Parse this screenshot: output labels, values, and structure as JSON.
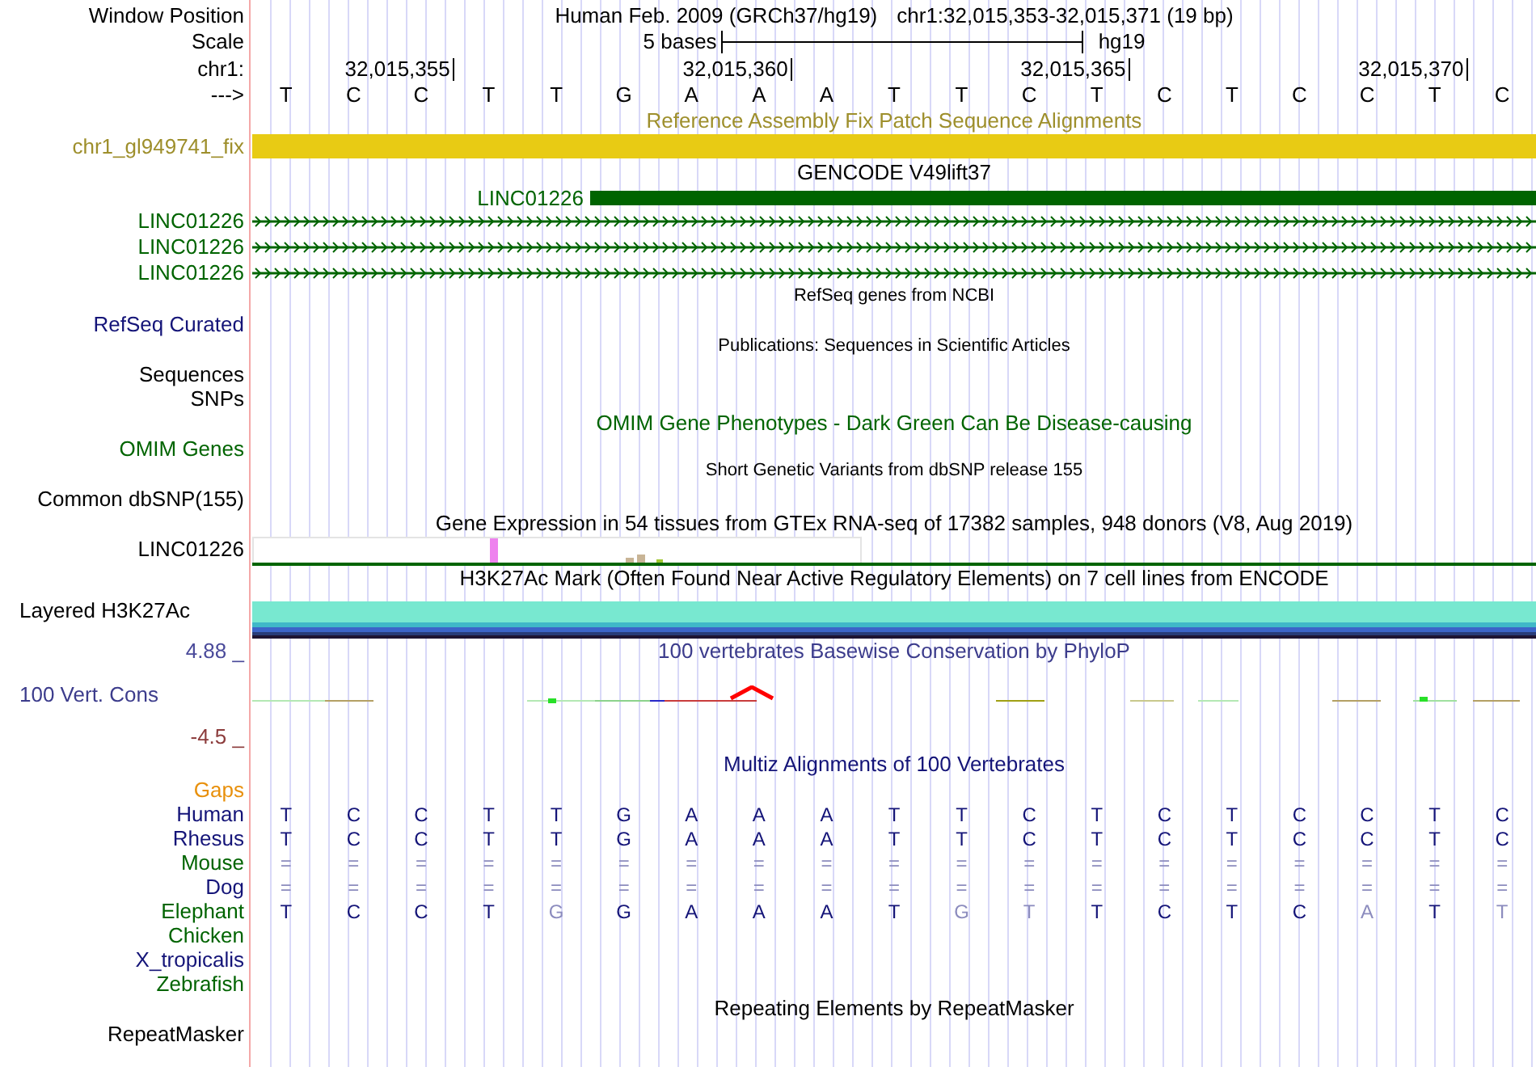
{
  "rows": [
    {
      "kind": "header",
      "label": "Window Position",
      "color": "#000000",
      "text": "Human Feb. 2009 (GRCh37/hg19)",
      "position": "chr1:32,015,353-32,015,371 (19 bp)"
    },
    {
      "kind": "scale",
      "label": "Scale",
      "color": "#000000",
      "text": "5 bases",
      "assembly": "hg19"
    },
    {
      "kind": "ruler",
      "label": "chr1:",
      "color": "#000000",
      "ticks": [
        "32,015,355",
        "32,015,360",
        "32,015,365",
        "32,015,370"
      ]
    },
    {
      "kind": "bases",
      "label": "--->",
      "color": "#000000",
      "bases": [
        "T",
        "C",
        "C",
        "T",
        "T",
        "G",
        "A",
        "A",
        "A",
        "T",
        "T",
        "C",
        "T",
        "C",
        "T",
        "C",
        "C",
        "T",
        "C"
      ]
    },
    {
      "kind": "title",
      "text": "Reference Assembly Fix Patch Sequence Alignments",
      "color": "#9e8f2c"
    },
    {
      "kind": "bar",
      "label": "chr1_gl949741_fix",
      "color": "#9e8f2c",
      "bar": {
        "color": "#e8cb14"
      }
    },
    {
      "kind": "title",
      "text": "GENCODE V49lift37",
      "color": "#000000"
    },
    {
      "kind": "gene",
      "name": "LINC01226",
      "color": "#006400"
    },
    {
      "kind": "transcript",
      "label": "LINC01226",
      "color": "#006400"
    },
    {
      "kind": "transcript",
      "label": "LINC01226",
      "color": "#006400"
    },
    {
      "kind": "transcript",
      "label": "LINC01226",
      "color": "#006400"
    },
    {
      "kind": "minor_title",
      "text": "RefSeq genes from NCBI",
      "color": "#000000"
    },
    {
      "kind": "label",
      "label": "RefSeq Curated",
      "color": "#141478"
    },
    {
      "kind": "minor_title",
      "text": "Publications: Sequences in Scientific Articles",
      "color": "#000000"
    },
    {
      "kind": "label",
      "label": "Sequences",
      "color": "#000000"
    },
    {
      "kind": "label",
      "label": "SNPs",
      "color": "#000000"
    },
    {
      "kind": "title",
      "text": "OMIM Gene Phenotypes - Dark Green Can Be Disease-causing",
      "color": "#006400"
    },
    {
      "kind": "label",
      "label": "OMIM Genes",
      "color": "#006400"
    },
    {
      "kind": "minor_title",
      "text": "Short Genetic Variants from dbSNP release 155",
      "color": "#000000"
    },
    {
      "kind": "label",
      "label": "Common dbSNP(155)",
      "color": "#000000"
    },
    {
      "kind": "title",
      "text": "Gene Expression in 54 tissues from GTEx RNA-seq of 17382 samples, 948 donors (V8, Aug 2019)",
      "color": "#000000"
    },
    {
      "kind": "expression",
      "label": "LINC01226",
      "color": "#000000"
    },
    {
      "kind": "title",
      "text": "H3K27Ac Mark (Often Found Near Active Regulatory Elements) on 7 cell lines from ENCODE",
      "color": "#000000"
    },
    {
      "kind": "layered",
      "label": "Layered H3K27Ac",
      "color": "#000000"
    },
    {
      "kind": "phylop",
      "title": "100 vertebrates Basewise Conservation by PhyloP",
      "max": "4.88 _",
      "label": "100 Vert. Cons",
      "min": "-4.5 _",
      "color": "#3c3c8c"
    },
    {
      "kind": "title",
      "text": "Multiz Alignments of 100 Vertebrates",
      "color": "#141478"
    },
    {
      "kind": "label",
      "label": "Gaps",
      "color": "#e8900c"
    },
    {
      "kind": "alignment",
      "label": "Human",
      "color": "#141478",
      "bases": [
        {
          "text": "T",
          "faded": false
        },
        {
          "text": "C",
          "faded": false
        },
        {
          "text": "C",
          "faded": false
        },
        {
          "text": "T",
          "faded": false
        },
        {
          "text": "T",
          "faded": false
        },
        {
          "text": "G",
          "faded": false
        },
        {
          "text": "A",
          "faded": false
        },
        {
          "text": "A",
          "faded": false
        },
        {
          "text": "A",
          "faded": false
        },
        {
          "text": "T",
          "faded": false
        },
        {
          "text": "T",
          "faded": false
        },
        {
          "text": "C",
          "faded": false
        },
        {
          "text": "T",
          "faded": false
        },
        {
          "text": "C",
          "faded": false
        },
        {
          "text": "T",
          "faded": false
        },
        {
          "text": "C",
          "faded": false
        },
        {
          "text": "C",
          "faded": false
        },
        {
          "text": "T",
          "faded": false
        },
        {
          "text": "C",
          "faded": false
        }
      ]
    },
    {
      "kind": "alignment",
      "label": "Rhesus",
      "color": "#141478",
      "bases": [
        {
          "text": "T",
          "faded": false
        },
        {
          "text": "C",
          "faded": false
        },
        {
          "text": "C",
          "faded": false
        },
        {
          "text": "T",
          "faded": false
        },
        {
          "text": "T",
          "faded": false
        },
        {
          "text": "G",
          "faded": false
        },
        {
          "text": "A",
          "faded": false
        },
        {
          "text": "A",
          "faded": false
        },
        {
          "text": "A",
          "faded": false
        },
        {
          "text": "T",
          "faded": false
        },
        {
          "text": "T",
          "faded": false
        },
        {
          "text": "C",
          "faded": false
        },
        {
          "text": "T",
          "faded": false
        },
        {
          "text": "C",
          "faded": false
        },
        {
          "text": "T",
          "faded": false
        },
        {
          "text": "C",
          "faded": false
        },
        {
          "text": "C",
          "faded": false
        },
        {
          "text": "T",
          "faded": false
        },
        {
          "text": "C",
          "faded": false
        }
      ]
    },
    {
      "kind": "alignment",
      "label": "Mouse",
      "color": "#006400",
      "bases": [
        {
          "text": "=",
          "faded": true
        },
        {
          "text": "=",
          "faded": true
        },
        {
          "text": "=",
          "faded": true
        },
        {
          "text": "=",
          "faded": true
        },
        {
          "text": "=",
          "faded": true
        },
        {
          "text": "=",
          "faded": true
        },
        {
          "text": "=",
          "faded": true
        },
        {
          "text": "=",
          "faded": true
        },
        {
          "text": "=",
          "faded": true
        },
        {
          "text": "=",
          "faded": true
        },
        {
          "text": "=",
          "faded": true
        },
        {
          "text": "=",
          "faded": true
        },
        {
          "text": "=",
          "faded": true
        },
        {
          "text": "=",
          "faded": true
        },
        {
          "text": "=",
          "faded": true
        },
        {
          "text": "=",
          "faded": true
        },
        {
          "text": "=",
          "faded": true
        },
        {
          "text": "=",
          "faded": true
        },
        {
          "text": "=",
          "faded": true
        }
      ]
    },
    {
      "kind": "alignment",
      "label": "Dog",
      "color": "#141478",
      "bases": [
        {
          "text": "=",
          "faded": true
        },
        {
          "text": "=",
          "faded": true
        },
        {
          "text": "=",
          "faded": true
        },
        {
          "text": "=",
          "faded": true
        },
        {
          "text": "=",
          "faded": true
        },
        {
          "text": "=",
          "faded": true
        },
        {
          "text": "=",
          "faded": true
        },
        {
          "text": "=",
          "faded": true
        },
        {
          "text": "=",
          "faded": true
        },
        {
          "text": "=",
          "faded": true
        },
        {
          "text": "=",
          "faded": true
        },
        {
          "text": "=",
          "faded": true
        },
        {
          "text": "=",
          "faded": true
        },
        {
          "text": "=",
          "faded": true
        },
        {
          "text": "=",
          "faded": true
        },
        {
          "text": "=",
          "faded": true
        },
        {
          "text": "=",
          "faded": true
        },
        {
          "text": "=",
          "faded": true
        },
        {
          "text": "=",
          "faded": true
        }
      ]
    },
    {
      "kind": "alignment",
      "label": "Elephant",
      "color": "#006400",
      "bases": [
        {
          "text": "T",
          "faded": false
        },
        {
          "text": "C",
          "faded": false
        },
        {
          "text": "C",
          "faded": false
        },
        {
          "text": "T",
          "faded": false
        },
        {
          "text": "G",
          "faded": true
        },
        {
          "text": "G",
          "faded": false
        },
        {
          "text": "A",
          "faded": false
        },
        {
          "text": "A",
          "faded": false
        },
        {
          "text": "A",
          "faded": false
        },
        {
          "text": "T",
          "faded": false
        },
        {
          "text": "G",
          "faded": true
        },
        {
          "text": "T",
          "faded": true
        },
        {
          "text": "T",
          "faded": false
        },
        {
          "text": "C",
          "faded": false
        },
        {
          "text": "T",
          "faded": false
        },
        {
          "text": "C",
          "faded": false
        },
        {
          "text": "A",
          "faded": true
        },
        {
          "text": "T",
          "faded": false
        },
        {
          "text": "T",
          "faded": true
        }
      ]
    },
    {
      "kind": "label",
      "label": "Chicken",
      "color": "#006400"
    },
    {
      "kind": "label",
      "label": "X_tropicalis",
      "color": "#141478"
    },
    {
      "kind": "label",
      "label": "Zebrafish",
      "color": "#006400"
    },
    {
      "kind": "title",
      "text": "Repeating Elements by RepeatMasker",
      "color": "#000000"
    },
    {
      "kind": "label",
      "label": "RepeatMasker",
      "color": "#000000"
    }
  ]
}
